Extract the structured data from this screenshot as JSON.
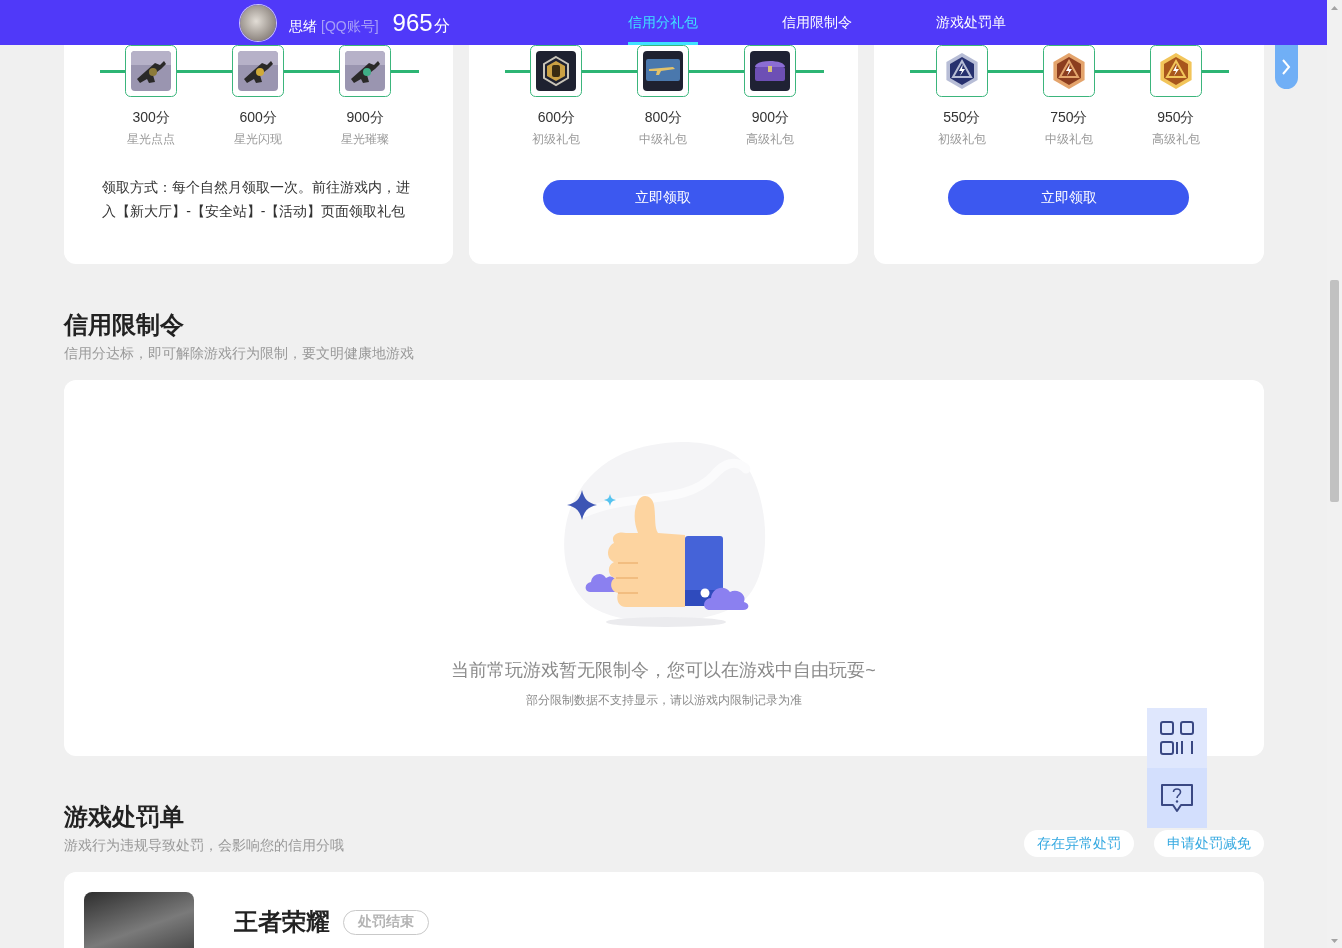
{
  "header": {
    "user": {
      "name": "思绪",
      "account_type": "[QQ账号]",
      "score": "965",
      "score_unit": "分"
    },
    "tabs": [
      {
        "label": "信用分礼包",
        "selected": true
      },
      {
        "label": "信用限制令",
        "selected": false
      },
      {
        "label": "游戏处罚单",
        "selected": false
      }
    ]
  },
  "gift_cards": [
    {
      "kind": "note",
      "tiers": [
        {
          "score": "300分",
          "name": "星光点点"
        },
        {
          "score": "600分",
          "name": "星光闪现"
        },
        {
          "score": "900分",
          "name": "星光璀璨"
        }
      ],
      "note": "领取方式：每个自然月领取一次。前往游戏内，进入【新大厅】-【安全站】-【活动】页面领取礼包"
    },
    {
      "kind": "button",
      "tiers": [
        {
          "score": "600分",
          "name": "初级礼包"
        },
        {
          "score": "800分",
          "name": "中级礼包"
        },
        {
          "score": "900分",
          "name": "高级礼包"
        }
      ],
      "button": "立即领取"
    },
    {
      "kind": "button",
      "tiers": [
        {
          "score": "550分",
          "name": "初级礼包"
        },
        {
          "score": "750分",
          "name": "中级礼包"
        },
        {
          "score": "950分",
          "name": "高级礼包"
        }
      ],
      "button": "立即领取"
    }
  ],
  "restriction_section": {
    "title": "信用限制令",
    "subtitle": "信用分达标，即可解除游戏行为限制，要文明健康地游戏",
    "empty_state": {
      "message": "当前常玩游戏暂无限制令，您可以在游戏中自由玩耍~",
      "note": "部分限制数据不支持显示，请以游戏内限制记录为准"
    }
  },
  "penalty_section": {
    "title": "游戏处罚单",
    "subtitle": "游戏行为违规导致处罚，会影响您的信用分哦",
    "actions": [
      "存在异常处罚",
      "申请处罚减免"
    ],
    "records": [
      {
        "game": "王者荣耀",
        "status": "处罚结束"
      }
    ]
  }
}
